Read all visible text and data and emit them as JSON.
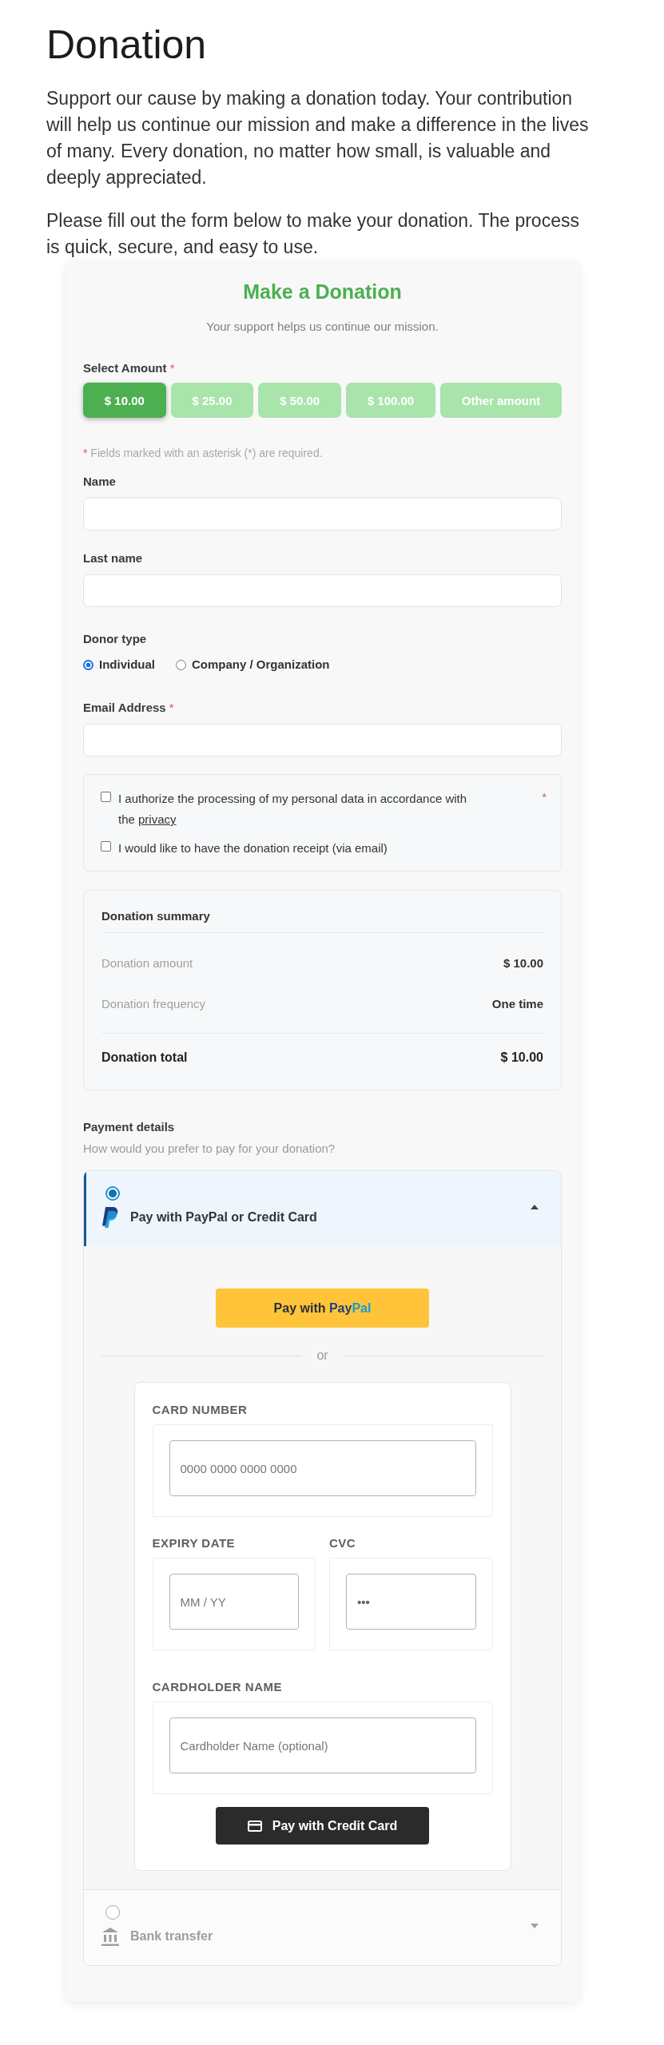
{
  "page": {
    "title": "Donation",
    "paragraphs": [
      "Support our cause by making a donation today. Your contribution will help us continue our mission and make a difference in the lives of many. Every donation, no matter how small, is valuable and deeply appreciated.",
      "Please fill out the form below to make your donation. The process is quick, secure, and easy to use."
    ]
  },
  "form": {
    "title": "Make a Donation",
    "subtitle": "Your support helps us continue our mission.",
    "amount": {
      "label": "Select Amount",
      "required_mark": "*",
      "options": [
        {
          "label": "$ 10.00",
          "selected": true
        },
        {
          "label": "$ 25.00",
          "selected": false
        },
        {
          "label": "$ 50.00",
          "selected": false
        },
        {
          "label": "$ 100.00",
          "selected": false
        },
        {
          "label": "Other amount",
          "selected": false
        }
      ]
    },
    "required_note": {
      "mark": "*",
      "text": "Fields marked with an asterisk (*) are required."
    },
    "name": {
      "label": "Name"
    },
    "last_name": {
      "label": "Last name"
    },
    "donor_type": {
      "label": "Donor type",
      "options": [
        {
          "label": "Individual",
          "selected": true
        },
        {
          "label": "Company / Organization",
          "selected": false
        }
      ]
    },
    "email": {
      "label": "Email Address",
      "required_mark": "*"
    },
    "consents": [
      {
        "text": "I authorize the processing of my personal data in accordance with the",
        "link": "privacy",
        "required_mark": "*",
        "checked": false
      },
      {
        "text": "I would like to have the donation receipt (via email)",
        "checked": false
      }
    ],
    "summary": {
      "title": "Donation summary",
      "rows": [
        {
          "label": "Donation amount",
          "value": "$ 10.00"
        },
        {
          "label": "Donation frequency",
          "value": "One time"
        }
      ],
      "total": {
        "label": "Donation total",
        "value": "$ 10.00"
      }
    },
    "payment": {
      "title": "Payment details",
      "subtitle": "How would you prefer to pay for your donation?",
      "methods": [
        {
          "kind": "paypal",
          "label": "Pay with PayPal or Credit Card",
          "selected": true,
          "expanded": true,
          "paypal_button": {
            "label": "Pay with",
            "logo_parts": [
              {
                "text": "Pay",
                "color": "#253b80"
              },
              {
                "text": "Pal",
                "color": "#179bd7"
              }
            ]
          },
          "separator": "or",
          "card_form": {
            "number": {
              "label": "CARD NUMBER",
              "placeholder": "0000 0000 0000 0000"
            },
            "expiry": {
              "label": "EXPIRY DATE",
              "placeholder": "MM / YY"
            },
            "cvc": {
              "label": "CVC",
              "placeholder": "•••"
            },
            "holder": {
              "label": "CARDHOLDER NAME",
              "placeholder": "Cardholder Name (optional)"
            },
            "button": {
              "label": "Pay with Credit Card"
            }
          }
        },
        {
          "kind": "bank",
          "label": "Bank transfer",
          "selected": false,
          "expanded": false
        }
      ]
    }
  }
}
